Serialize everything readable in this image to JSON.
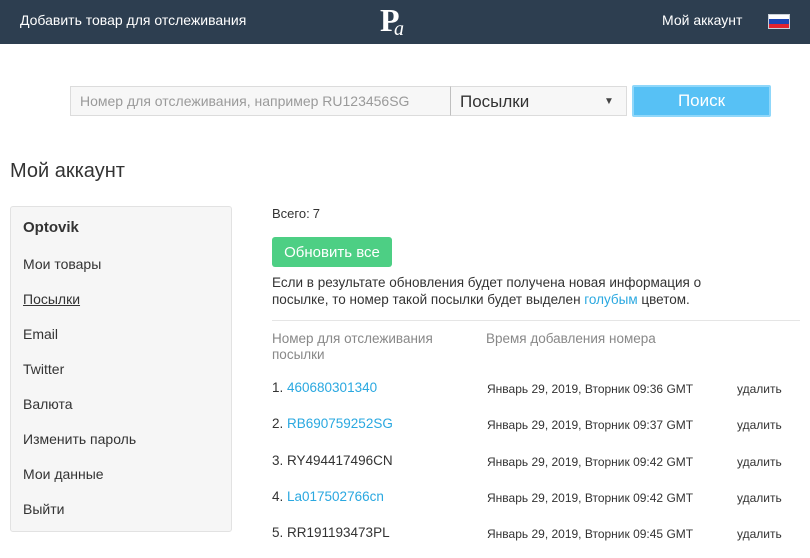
{
  "header": {
    "add_item_link": "Добавить товар для отслеживания",
    "account_link": "Мой аккаунт",
    "flag_colors": [
      "#ffffff",
      "#1c46b2",
      "#e2222e"
    ]
  },
  "search": {
    "placeholder": "Номер для отслеживания, например RU123456SG",
    "value": "",
    "type_selected": "Посылки",
    "button_label": "Поиск"
  },
  "page_title": "Мой аккаунт",
  "sidebar": {
    "user_name": "Optovik",
    "items": [
      {
        "label": "Мои товары"
      },
      {
        "label": "Посылки"
      },
      {
        "label": "Email"
      },
      {
        "label": "Twitter"
      },
      {
        "label": "Валюта"
      },
      {
        "label": "Изменить пароль"
      },
      {
        "label": "Мои данные"
      },
      {
        "label": "Выйти"
      }
    ],
    "active_index": 1
  },
  "summary": {
    "total_label": "Всего:",
    "total_value": "7",
    "refresh_button": "Обновить все",
    "note_before": "Если в результате обновления будет получена новая информация о посылке, то номер такой посылки будет выделен ",
    "note_highlight": "голубым",
    "note_after": " цветом."
  },
  "table": {
    "columns": [
      "Номер для отслеживания посылки",
      "Время добавления номера"
    ],
    "delete_label": "удалить",
    "rows": [
      {
        "num": "1.",
        "track": "460680301340",
        "updated": true,
        "date": "Январь 29, 2019, Вторник 09:36 GMT"
      },
      {
        "num": "2.",
        "track": "RB690759252SG",
        "updated": true,
        "date": "Январь 29, 2019, Вторник 09:37 GMT"
      },
      {
        "num": "3.",
        "track": "RY494417496CN",
        "updated": false,
        "date": "Январь 29, 2019, Вторник 09:42 GMT"
      },
      {
        "num": "4.",
        "track": "La017502766cn",
        "updated": true,
        "date": "Январь 29, 2019, Вторник 09:42 GMT"
      },
      {
        "num": "5.",
        "track": "RR191193473PL",
        "updated": false,
        "date": "Январь 29, 2019, Вторник 09:45 GMT"
      }
    ]
  },
  "colors": {
    "header_bg": "#2d3e50",
    "search_button": "#57c1f5",
    "refresh_button": "#4dcf84",
    "link": "#2aa8e0"
  }
}
